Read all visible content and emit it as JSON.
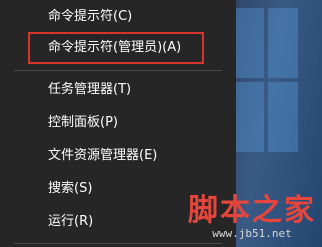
{
  "menu": {
    "items": [
      {
        "label": "命令提示符(C)"
      },
      {
        "label": "命令提示符(管理员)(A)"
      },
      {
        "label": "任务管理器(T)"
      },
      {
        "label": "控制面板(P)"
      },
      {
        "label": "文件资源管理器(E)"
      },
      {
        "label": "搜索(S)"
      },
      {
        "label": "运行(R)"
      }
    ]
  },
  "watermark": {
    "title": "脚本之家",
    "url": "www.jb51.net"
  },
  "colors": {
    "menu_bg": "#262626",
    "highlight_border": "#d9342b",
    "watermark_red": "#e4453c"
  }
}
